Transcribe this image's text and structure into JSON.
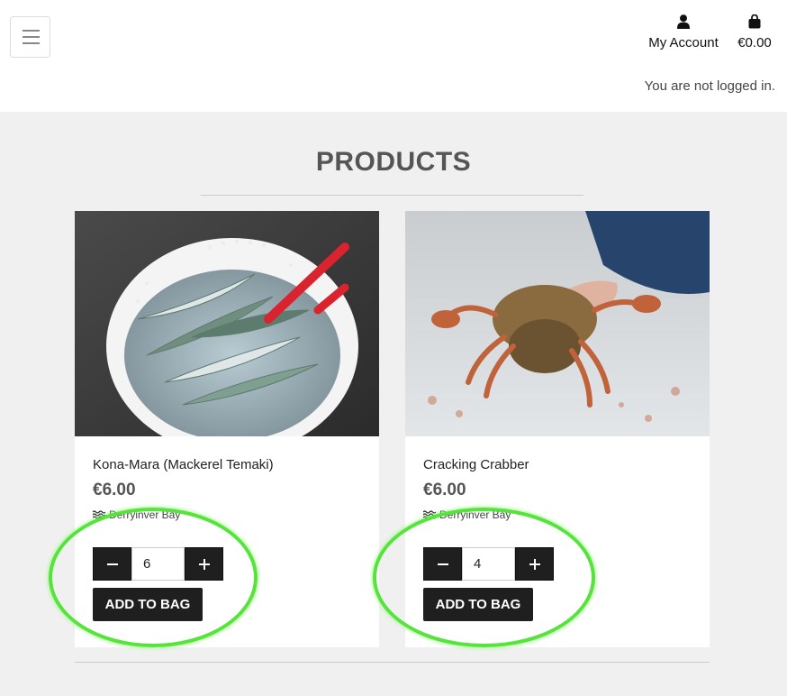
{
  "header": {
    "account_label": "My Account",
    "bag_total": "€0.00",
    "login_status": "You are not logged in."
  },
  "page": {
    "title": "PRODUCTS"
  },
  "products": [
    {
      "name": "Kona-Mara (Mackerel Temaki)",
      "price": "€6.00",
      "location": "Derryinver Bay",
      "quantity": "6",
      "add_label": "ADD TO BAG"
    },
    {
      "name": "Cracking Crabber",
      "price": "€6.00",
      "location": "Derryinver Bay",
      "quantity": "4",
      "add_label": "ADD TO BAG"
    }
  ],
  "icons": [
    "menu-icon",
    "user-icon",
    "shopping-bag-icon",
    "water-icon",
    "minus-icon",
    "plus-icon"
  ],
  "colors": {
    "button": "#1f1f1f",
    "highlight": "#55e33c",
    "background": "#f0f0f0"
  }
}
